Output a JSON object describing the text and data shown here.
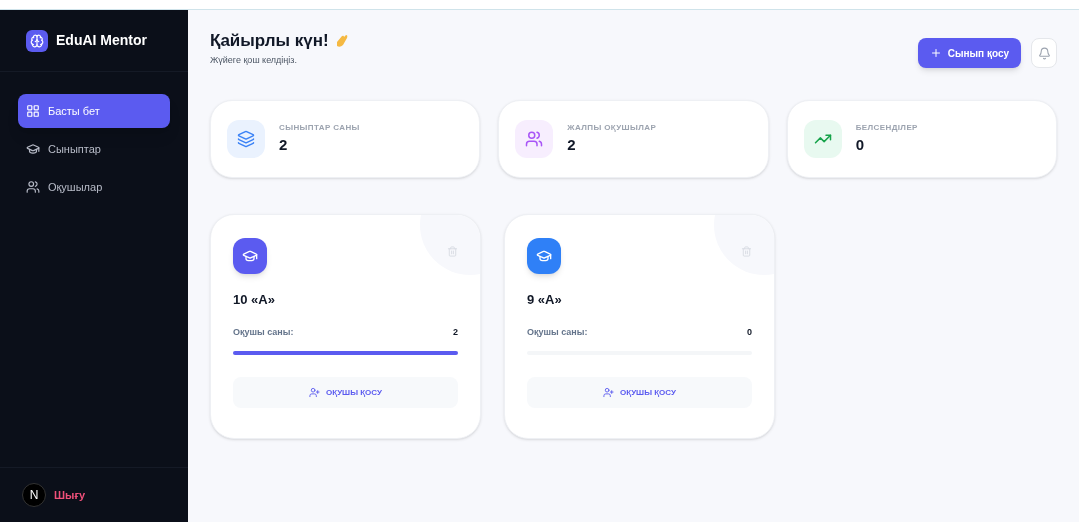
{
  "sidebar": {
    "logo": "EduAI Mentor",
    "items": [
      {
        "label": "Басты бет",
        "selected": true
      },
      {
        "label": "Сыныптар",
        "selected": false
      },
      {
        "label": "Оқушылар",
        "selected": false
      }
    ],
    "avatar": "N",
    "logout": "Шығу"
  },
  "header": {
    "title": "Қайырлы күн!",
    "subtitle": "Жүйеге қош келдіңіз.",
    "add_button": "Сынып қосу"
  },
  "stats": [
    {
      "label": "СЫНЫПТАР САНЫ",
      "value": "2"
    },
    {
      "label": "ЖАЛПЫ ОҚУШЫЛАР",
      "value": "2"
    },
    {
      "label": "БЕЛСЕНДІЛЕР",
      "value": "0"
    }
  ],
  "classes": [
    {
      "name": "10 «А»",
      "color": "#5b5bf0",
      "count_label": "Оқушы саны:",
      "count": "2",
      "level": 1,
      "button": "ОҚУШЫ ҚОСУ"
    },
    {
      "name": "9 «А»",
      "color": "#2f80f7",
      "count_label": "Оқушы саны:",
      "count": "0",
      "level": 0,
      "button": "ОҚУШЫ ҚОСУ"
    }
  ]
}
